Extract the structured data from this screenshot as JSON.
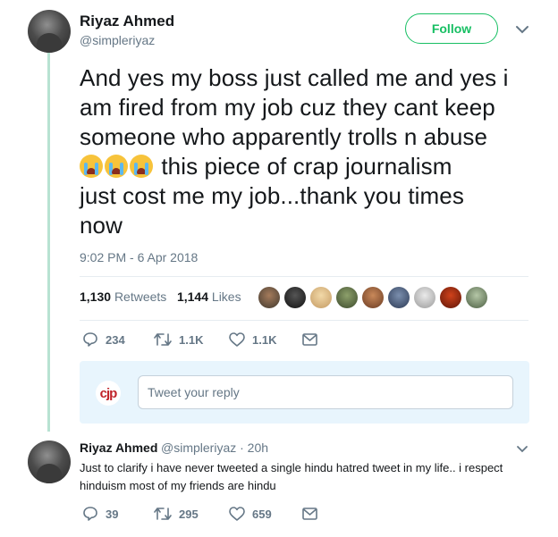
{
  "main_tweet": {
    "name": "Riyaz Ahmed",
    "handle": "@simpleriyaz",
    "follow_label": "Follow",
    "text_line1": "And yes my boss just called me and yes i",
    "text_line2": "am fired from my job cuz they cant keep",
    "text_line3": "someone who apparently trolls n abuse",
    "text_line4": " this piece of crap journalism",
    "text_line5": "just cost me my job...thank you times",
    "text_line6": "now",
    "emoji": "loudly-crying-face",
    "timestamp": "9:02 PM - 6 Apr 2018",
    "retweets_count": "1,130",
    "retweets_label": "Retweets",
    "likes_count": "1,144",
    "likes_label": "Likes",
    "actions": {
      "replies": "234",
      "retweets": "1.1K",
      "likes": "1.1K"
    }
  },
  "reply_box": {
    "logo_text": "cjp",
    "placeholder": "Tweet your reply"
  },
  "reply_tweet": {
    "name": "Riyaz Ahmed",
    "handle_time": "@simpleriyaz · 20h",
    "text": "Just to clarify i have never tweeted a single hindu hatred tweet in my life.. i respect hinduism most of my friends are hindu",
    "actions": {
      "replies": "39",
      "retweets": "295",
      "likes": "659"
    }
  },
  "colors": {
    "follow_green": "#17bf63",
    "thread_line": "#b8e2d2",
    "muted_text": "#657786",
    "reply_box_bg": "#e8f5fd"
  }
}
